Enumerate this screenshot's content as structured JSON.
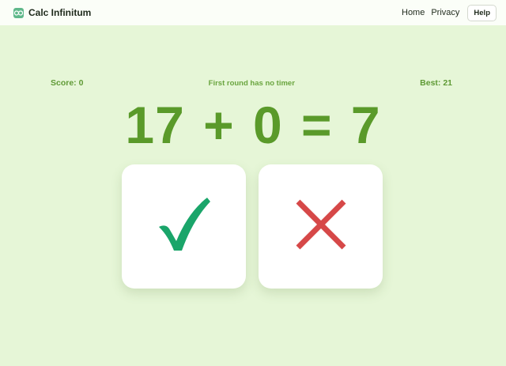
{
  "header": {
    "brand": "Calc Infinitum",
    "logo_icon": "infinity-icon",
    "nav": {
      "home": "Home",
      "privacy": "Privacy",
      "help": "Help"
    }
  },
  "game": {
    "score_label": "Score: 0",
    "hint": "First round has no timer",
    "best_label": "Best: 21",
    "equation": "17 + 0 = 7",
    "buttons": {
      "correct_icon": "checkmark-icon",
      "wrong_icon": "cross-icon"
    }
  },
  "colors": {
    "background": "#e6f6d7",
    "equation": "#5a9a2a",
    "check": "#1aa56a",
    "cross": "#d64848"
  }
}
